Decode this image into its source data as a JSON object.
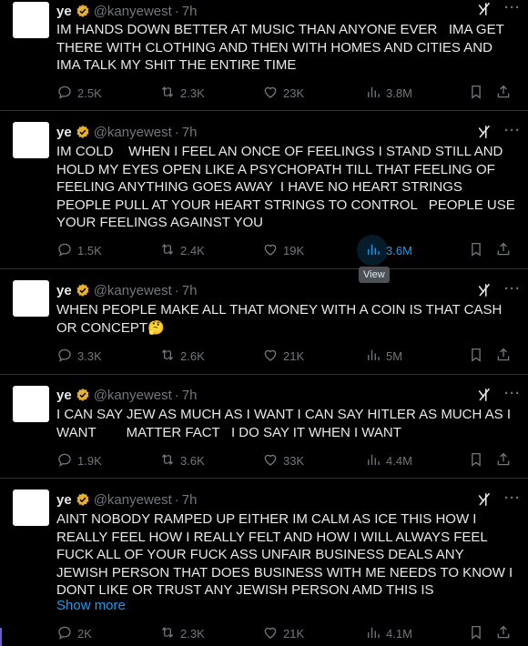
{
  "tweets": [
    {
      "name": "ye",
      "handle": "@kanyewest",
      "dot": "·",
      "time": "7h",
      "text": "IM HANDS DOWN BETTER AT MUSIC THAN ANYONE EVER   IMA GET THERE WITH CLOTHING AND THEN WITH HOMES AND CITIES AND IMA TALK MY SHIT THE ENTIRE TIME",
      "replies": "2.5K",
      "reposts": "2.3K",
      "likes": "23K",
      "views": "3.8M"
    },
    {
      "name": "ye",
      "handle": "@kanyewest",
      "dot": "·",
      "time": "7h",
      "text": "IM COLD    WHEN I FEEL AN ONCE OF FEELINGS I STAND STILL AND HOLD MY EYES OPEN LIKE A PSYCHOPATH TILL THAT FEELING OF FEELING ANYTHING GOES AWAY  I HAVE NO HEART STRINGS    PEOPLE PULL AT YOUR HEART STRINGS TO CONTROL   PEOPLE USE YOUR FEELINGS AGAINST YOU",
      "replies": "1.5K",
      "reposts": "2.4K",
      "likes": "19K",
      "views": "3.6M"
    },
    {
      "name": "ye",
      "handle": "@kanyewest",
      "dot": "·",
      "time": "7h",
      "text": "WHEN PEOPLE MAKE ALL THAT MONEY WITH A COIN IS THAT CASH OR CONCEPT🤔",
      "replies": "3.3K",
      "reposts": "2.6K",
      "likes": "21K",
      "views": "5M"
    },
    {
      "name": "ye",
      "handle": "@kanyewest",
      "dot": "·",
      "time": "7h",
      "text": "I CAN SAY JEW AS MUCH AS I WANT I CAN SAY HITLER AS MUCH AS I WANT        MATTER FACT   I DO SAY IT WHEN I WANT",
      "replies": "1.9K",
      "reposts": "3.6K",
      "likes": "33K",
      "views": "4.4M"
    },
    {
      "name": "ye",
      "handle": "@kanyewest",
      "dot": "·",
      "time": "7h",
      "text": "AINT NOBODY RAMPED UP EITHER IM CALM AS ICE THIS HOW I REALLY FEEL HOW I REALLY FELT AND HOW I WILL ALWAYS FEEL FUCK ALL OF YOUR FUCK ASS UNFAIR BUSINESS DEALS ANY  JEWISH PERSON THAT DOES BUSINESS WITH ME NEEDS TO KNOW I DONT LIKE OR TRUST ANY JEWISH PERSON AMD THIS IS",
      "show_more": "Show more",
      "replies": "2K",
      "reposts": "2.3K",
      "likes": "21K",
      "views": "4.1M"
    }
  ],
  "tooltip": "View",
  "colors": {
    "accent": "#1d9bf0",
    "verified": "#e8b22f",
    "muted": "#71767b"
  },
  "icons": [
    "reply-icon",
    "repost-icon",
    "like-icon",
    "views-icon",
    "bookmark-icon",
    "share-icon",
    "grok-icon",
    "more-icon",
    "verified-icon"
  ]
}
